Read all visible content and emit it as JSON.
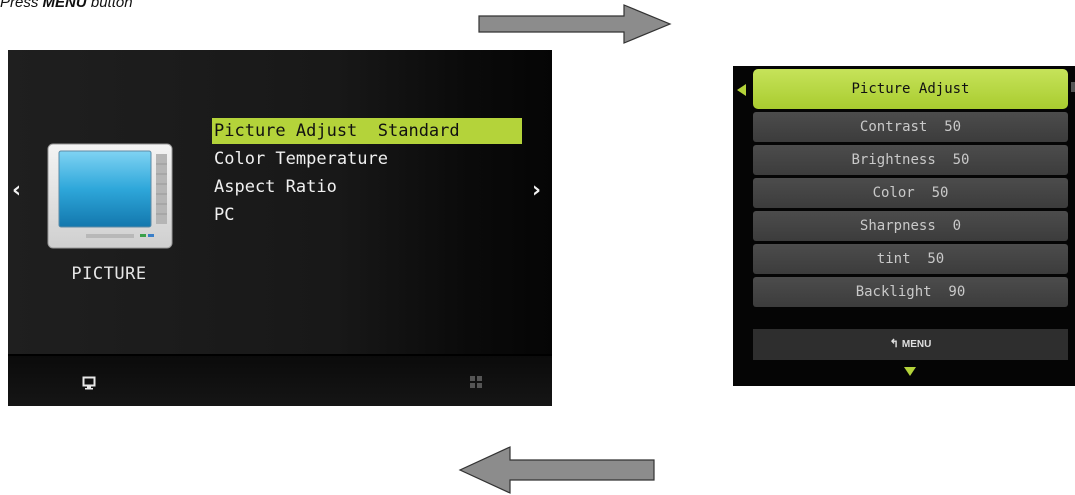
{
  "caption": {
    "prefix": "Press ",
    "key": "MENU",
    "suffix": " button"
  },
  "main_menu": {
    "category_label": "PICTURE",
    "items": [
      {
        "label": "Picture Adjust  Standard",
        "selected": true
      },
      {
        "label": "Color Temperature",
        "selected": false
      },
      {
        "label": "Aspect Ratio",
        "selected": false
      },
      {
        "label": "PC",
        "selected": false
      }
    ],
    "nav_left": "‹",
    "nav_right": "›",
    "bottom_icons": [
      "monitor-icon",
      "grid-icon"
    ]
  },
  "sub_menu": {
    "title": "Picture Adjust",
    "items": [
      {
        "label": "Contrast  50"
      },
      {
        "label": "Brightness  50"
      },
      {
        "label": "Color  50"
      },
      {
        "label": "Sharpness  0"
      },
      {
        "label": "tint  50"
      },
      {
        "label": "Backlight  90"
      }
    ],
    "footer_label": "MENU",
    "footer_icon": "return-icon"
  },
  "colors": {
    "accent_green": "#b4d33a",
    "arrow_gray": "#8c8c8c"
  }
}
